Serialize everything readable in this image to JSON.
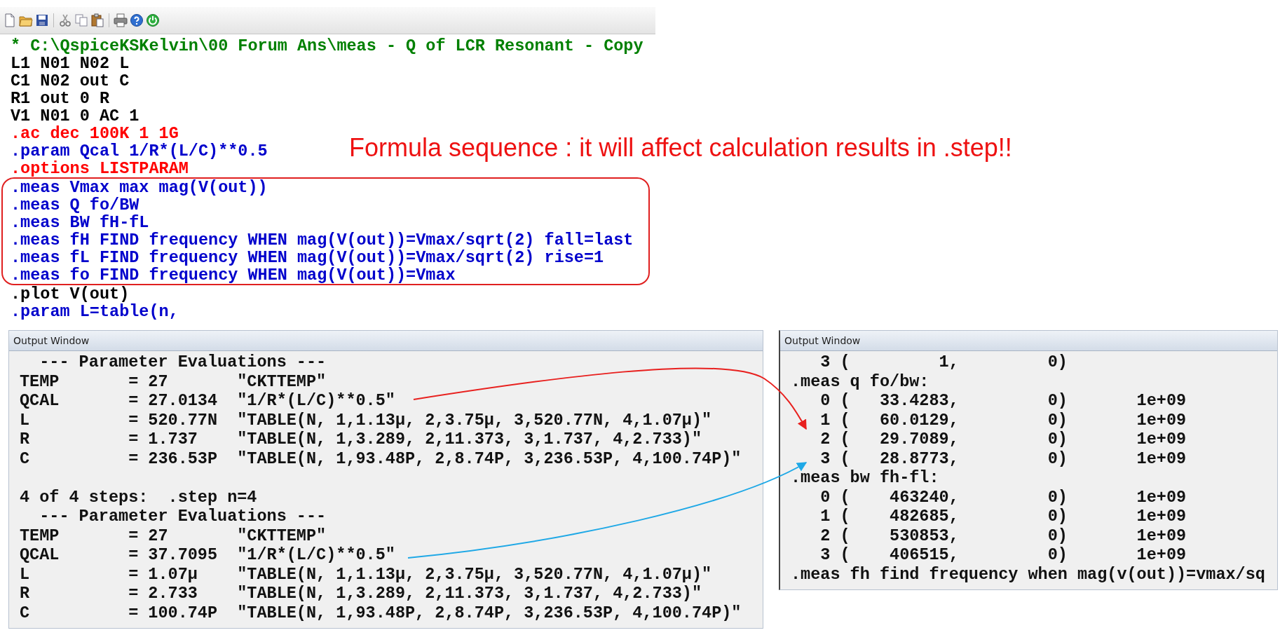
{
  "netlist": {
    "sections": [
      {
        "boxed": false,
        "lines": [
          {
            "text": "* C:\\QspiceKSKelvin\\00 Forum Ans\\meas - Q of LCR Resonant - Copy",
            "color": "#008000"
          },
          {
            "text": "L1 N01 N02 L",
            "color": "#000000"
          },
          {
            "text": "C1 N02 out C",
            "color": "#000000"
          },
          {
            "text": "R1 out 0 R",
            "color": "#000000"
          },
          {
            "text": "V1 N01 0 AC 1",
            "color": "#000000"
          },
          {
            "text": ".ac dec 100K 1 1G",
            "color": "#ff0000"
          },
          {
            "text": ".param Qcal 1/R*(L/C)**0.5",
            "color": "#0000cc"
          },
          {
            "text": ".options LISTPARAM",
            "color": "#ff0000"
          }
        ]
      },
      {
        "boxed": true,
        "lines": [
          {
            "text": ".meas Vmax max mag(V(out))",
            "color": "#0000cc"
          },
          {
            "text": ".meas Q fo/BW",
            "color": "#0000cc"
          },
          {
            "text": ".meas BW fH-fL",
            "color": "#0000cc"
          },
          {
            "text": ".meas fH FIND frequency WHEN mag(V(out))=Vmax/sqrt(2) fall=last",
            "color": "#0000cc"
          },
          {
            "text": ".meas fL FIND frequency WHEN mag(V(out))=Vmax/sqrt(2) rise=1",
            "color": "#0000cc"
          },
          {
            "text": ".meas fo FIND frequency WHEN mag(V(out))=Vmax",
            "color": "#0000cc"
          }
        ]
      },
      {
        "boxed": false,
        "lines": [
          {
            "text": ".plot V(out)",
            "color": "#000000"
          },
          {
            "text": ".param L=table(n,",
            "color": "#0000cc"
          }
        ]
      }
    ]
  },
  "annotation": {
    "text": "Formula sequence : it will affect calculation results in .step!!"
  },
  "output_windows": [
    {
      "title": "Output Window",
      "blocks": [
        {
          "lines": [
            "  --- Parameter Evaluations ---",
            "TEMP       = 27       \"CKTTEMP\"",
            "QCAL       = 27.0134  \"1/R*(L/C)**0.5\"",
            "L          = 520.77N  \"TABLE(N, 1,1.13µ, 2,3.75µ, 3,520.77N, 4,1.07µ)\"",
            "R          = 1.737    \"TABLE(N, 1,3.289, 2,11.373, 3,1.737, 4,2.733)\"",
            "C          = 236.53P  \"TABLE(N, 1,93.48P, 2,8.74P, 3,236.53P, 4,100.74P)\""
          ]
        },
        {
          "lines": [
            "4 of 4 steps:  .step n=4",
            "  --- Parameter Evaluations ---",
            "TEMP       = 27       \"CKTTEMP\"",
            "QCAL       = 37.7095  \"1/R*(L/C)**0.5\"",
            "L          = 1.07µ    \"TABLE(N, 1,1.13µ, 2,3.75µ, 3,520.77N, 4,1.07µ)\"",
            "R          = 2.733    \"TABLE(N, 1,3.289, 2,11.373, 3,1.737, 4,2.733)\"",
            "C          = 100.74P  \"TABLE(N, 1,93.48P, 2,8.74P, 3,236.53P, 4,100.74P)\""
          ]
        }
      ]
    },
    {
      "title": "Output Window",
      "blocks": [
        {
          "lines": [
            "   3 (         1,         0)",
            ".meas q fo/bw:",
            "   0 (   33.4283,         0)       1e+09",
            "   1 (   60.0129,         0)       1e+09",
            "   2 (   29.7089,         0)       1e+09",
            "   3 (   28.8773,         0)       1e+09",
            ".meas bw fh-fl:",
            "   0 (    463240,         0)       1e+09",
            "   1 (    482685,         0)       1e+09",
            "   2 (    530853,         0)       1e+09",
            "   3 (    406515,         0)       1e+09",
            ".meas fh find frequency when mag(v(out))=vmax/sq"
          ]
        }
      ]
    }
  ],
  "arrows": [
    {
      "color": "#e8201e"
    },
    {
      "color": "#1ea8e6"
    }
  ]
}
